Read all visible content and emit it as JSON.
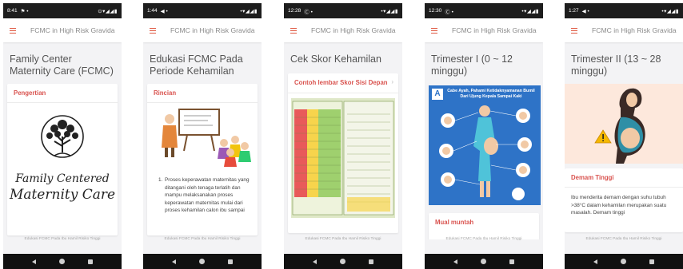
{
  "app": {
    "title": "FCMC in High Risk Gravida",
    "footer": "Edukasi FCMC Pada Ibu Hamil Risiko Tinggi"
  },
  "colors": {
    "accent": "#e05a44",
    "heading": "#d9534f",
    "statusbar": "#1d1d1d",
    "navbar": "#111111"
  },
  "screens": [
    {
      "time": "8:41",
      "status_extra": "⚑ •",
      "signal": "⊙▾◢◢▮",
      "title": "Family Center Maternity Care (FCMC)",
      "card_heading": "Pengertian",
      "logo_line1": "Family Centered",
      "logo_line2": "Maternity Care"
    },
    {
      "time": "1:44",
      "status_extra": "◀ •",
      "signal": "•▾◢◢▮",
      "title": "Edukasi FCMC Pada Periode Kehamilan",
      "card_heading": "Rincian",
      "list_number": "1.",
      "body": "Proses keperawatan maternitas yang ditangani oleh tenaga terlatih dan mampu melaksanakan proses keperawatan maternitas mulai dari proses kehamilan calon ibu sampai"
    },
    {
      "time": "12:28",
      "status_extra": "Ⓒ •",
      "signal": "•▾◢◢▮",
      "title": "Cek Skor Kehamilan",
      "card_heading": "Contoh lembar Skor Sisi Depan"
    },
    {
      "time": "12:30",
      "status_extra": "Ⓒ •",
      "signal": "•▾◢◢▮",
      "title": "Trimester I (0 ~ 12 minggu)",
      "poster_letter": "A",
      "poster_title": "Cabe Ayah, Pahami Ketidaknyamanan Bumil Dari Ujung Kepala Sampai Kaki",
      "card_heading": "Mual muntah"
    },
    {
      "time": "1:27",
      "status_extra": "◀ •",
      "signal": "•▾◢◢▮",
      "title": "Trimester II (13 ~ 28 minggu)",
      "card_heading": "Demam Tinggi",
      "body": "Ibu menderita demam dengan suhu tubuh >38°C dalam kehamilan merupakan suatu masalah. Demam tinggi"
    }
  ]
}
